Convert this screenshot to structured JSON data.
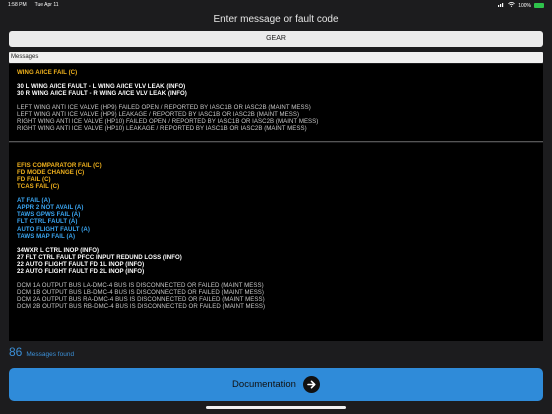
{
  "status_bar": {
    "time": "1:58 PM",
    "date": "Tue Apr 11",
    "battery": "100%"
  },
  "header": {
    "title": "Enter message or fault code"
  },
  "search": {
    "value": "GEAR"
  },
  "messages_label": "Messages",
  "panel1": [
    {
      "text": "WING A/ICE FAIL (C)",
      "style": "yellow"
    },
    {
      "text": "",
      "style": "gap"
    },
    {
      "text": "30 L WING A/ICE FAULT - L WING A/ICE VLV LEAK (INFO)",
      "style": "white"
    },
    {
      "text": "30 R WING A/ICE FAULT - R WING A/ICE VLV LEAK (INFO)",
      "style": "white"
    },
    {
      "text": "",
      "style": "gap"
    },
    {
      "text": "LEFT WING ANTI ICE VALVE (HP9) FAILED OPEN / REPORTED BY IASC1B OR IASC2B (MAINT MESS)",
      "style": "grey"
    },
    {
      "text": "LEFT WING ANTI ICE VALVE (HP9) LEAKAGE / REPORTED BY IASC1B OR IASC2B (MAINT MESS)",
      "style": "grey"
    },
    {
      "text": "RIGHT WING ANTI ICE VALVE (HP10) FAILED OPEN / REPORTED BY IASC1B OR IASC2B (MAINT MESS)",
      "style": "grey"
    },
    {
      "text": "RIGHT WING ANTI ICE VALVE (HP10) LEAKAGE / REPORTED BY IASC1B OR IASC2B (MAINT MESS)",
      "style": "grey"
    }
  ],
  "panel2": [
    {
      "text": "",
      "style": "gap"
    },
    {
      "text": "",
      "style": "gap"
    },
    {
      "text": "EFIS COMPARATOR FAIL (C)",
      "style": "yellow"
    },
    {
      "text": "FD MODE CHANGE (C)",
      "style": "yellow"
    },
    {
      "text": "FD FAIL (C)",
      "style": "yellow"
    },
    {
      "text": "TCAS FAIL (C)",
      "style": "yellow"
    },
    {
      "text": "",
      "style": "gap"
    },
    {
      "text": "AT FAIL (A)",
      "style": "blue"
    },
    {
      "text": "APPR 2 NOT AVAIL (A)",
      "style": "blue"
    },
    {
      "text": "TAWS GPWS FAIL (A)",
      "style": "blue"
    },
    {
      "text": "FLT CTRL FAULT (A)",
      "style": "blue"
    },
    {
      "text": "AUTO FLIGHT FAULT (A)",
      "style": "blue"
    },
    {
      "text": "TAWS MAP FAIL (A)",
      "style": "blue"
    },
    {
      "text": "",
      "style": "gap"
    },
    {
      "text": "34WXR L CTRL INOP (INFO)",
      "style": "white"
    },
    {
      "text": "27 FLT CTRL FAULT PFCC INPUT REDUND LOSS (INFO)",
      "style": "white"
    },
    {
      "text": "22 AUTO FLIGHT FAULT FD 1L INOP (INFO)",
      "style": "white"
    },
    {
      "text": "22 AUTO FLIGHT FAULT FD 2L INOP (INFO)",
      "style": "white"
    },
    {
      "text": "",
      "style": "gap"
    },
    {
      "text": "DCM 1A OUTPUT BUS LA-DMC-4 BUS IS DISCONNECTED OR FAILED  (MAINT MESS)",
      "style": "grey"
    },
    {
      "text": "DCM 1B OUTPUT BUS LB-DMC-4 BUS IS DISCONNECTED OR FAILED (MAINT MESS)",
      "style": "grey"
    },
    {
      "text": "DCM 2A OUTPUT BUS RA-DMC-4 BUS IS DISCONNECTED OR FAILED (MAINT MESS)",
      "style": "grey"
    },
    {
      "text": "DCM 2B OUTPUT BUS RB-DMC-4 BUS IS DISCONNECTED OR FAILED (MAINT MESS)",
      "style": "grey"
    }
  ],
  "results": {
    "count": "86",
    "label": "Messages found"
  },
  "documentation_button": {
    "label": "Documentation",
    "icon": "arrow-right-icon"
  },
  "colors": {
    "caution": "#f2b31d",
    "advisory": "#3aa6f2",
    "accent": "#2f8bd9"
  }
}
